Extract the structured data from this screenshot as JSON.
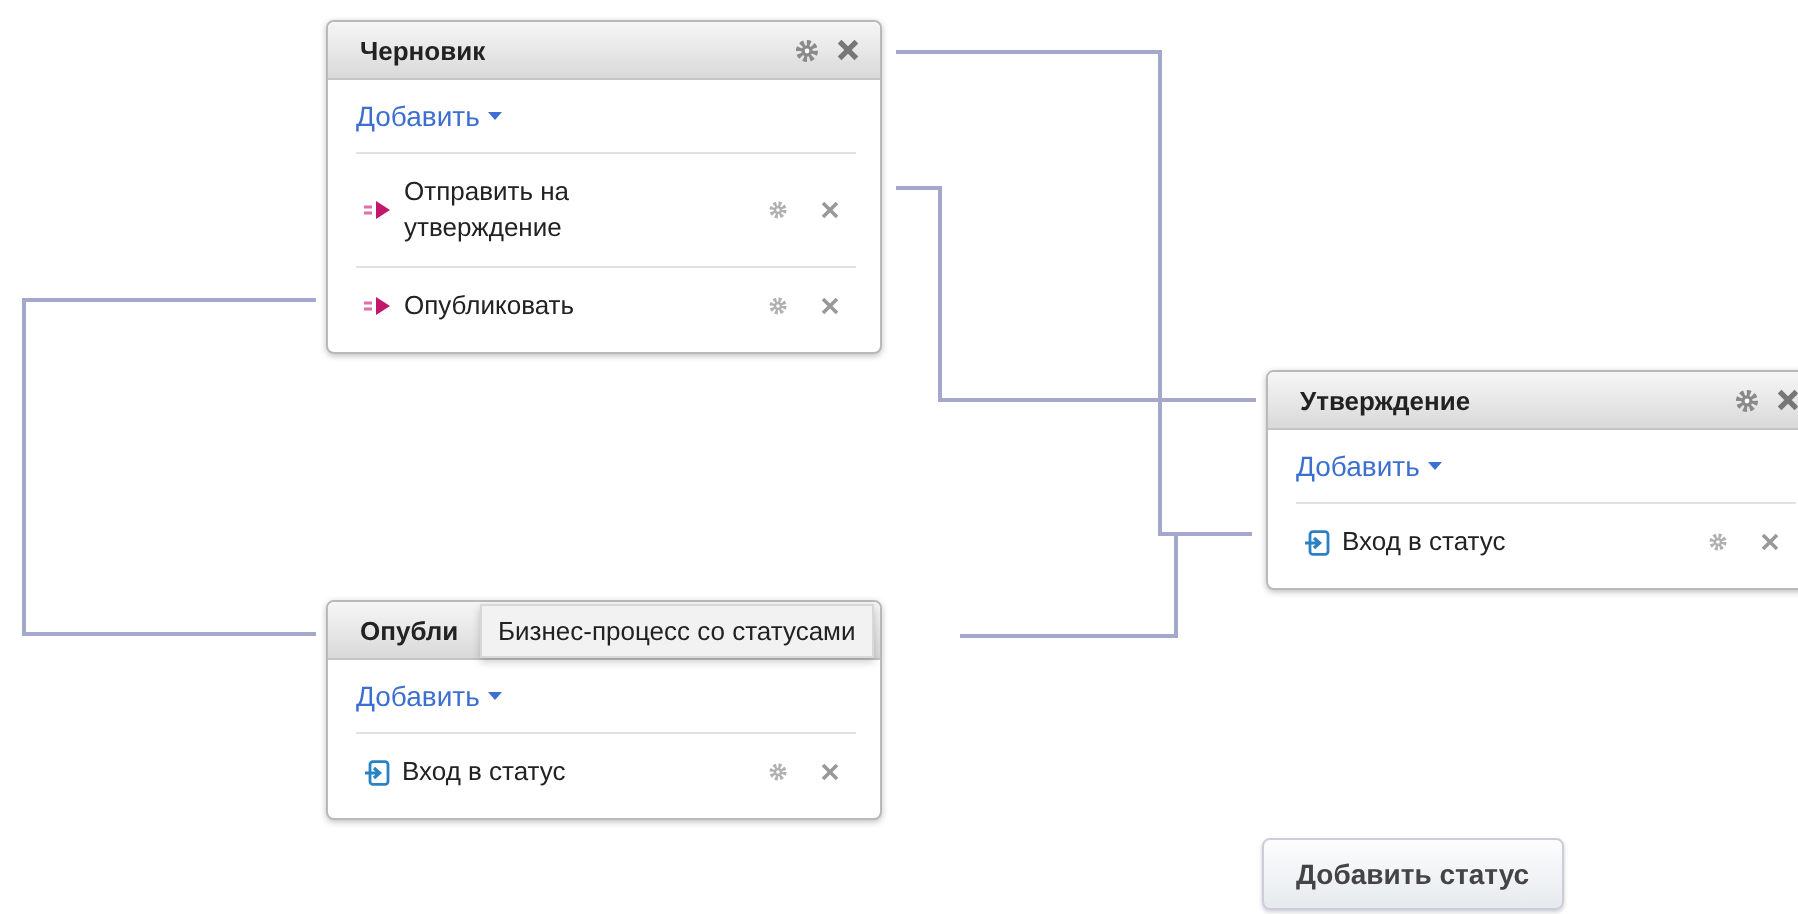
{
  "statuses": [
    {
      "title": "Черновик",
      "add_label": "Добавить",
      "actions": [
        {
          "kind": "transition",
          "label": "Отправить на утверждение"
        },
        {
          "kind": "transition",
          "label": "Опубликовать"
        }
      ]
    },
    {
      "title": "Опубли",
      "tooltip": "Бизнес-процесс со статусами",
      "add_label": "Добавить",
      "actions": [
        {
          "kind": "entry",
          "label": "Вход в статус"
        }
      ]
    },
    {
      "title": "Утверждение",
      "add_label": "Добавить",
      "actions": [
        {
          "kind": "entry",
          "label": "Вход в статус"
        }
      ]
    }
  ],
  "add_status_button": "Добавить статус"
}
